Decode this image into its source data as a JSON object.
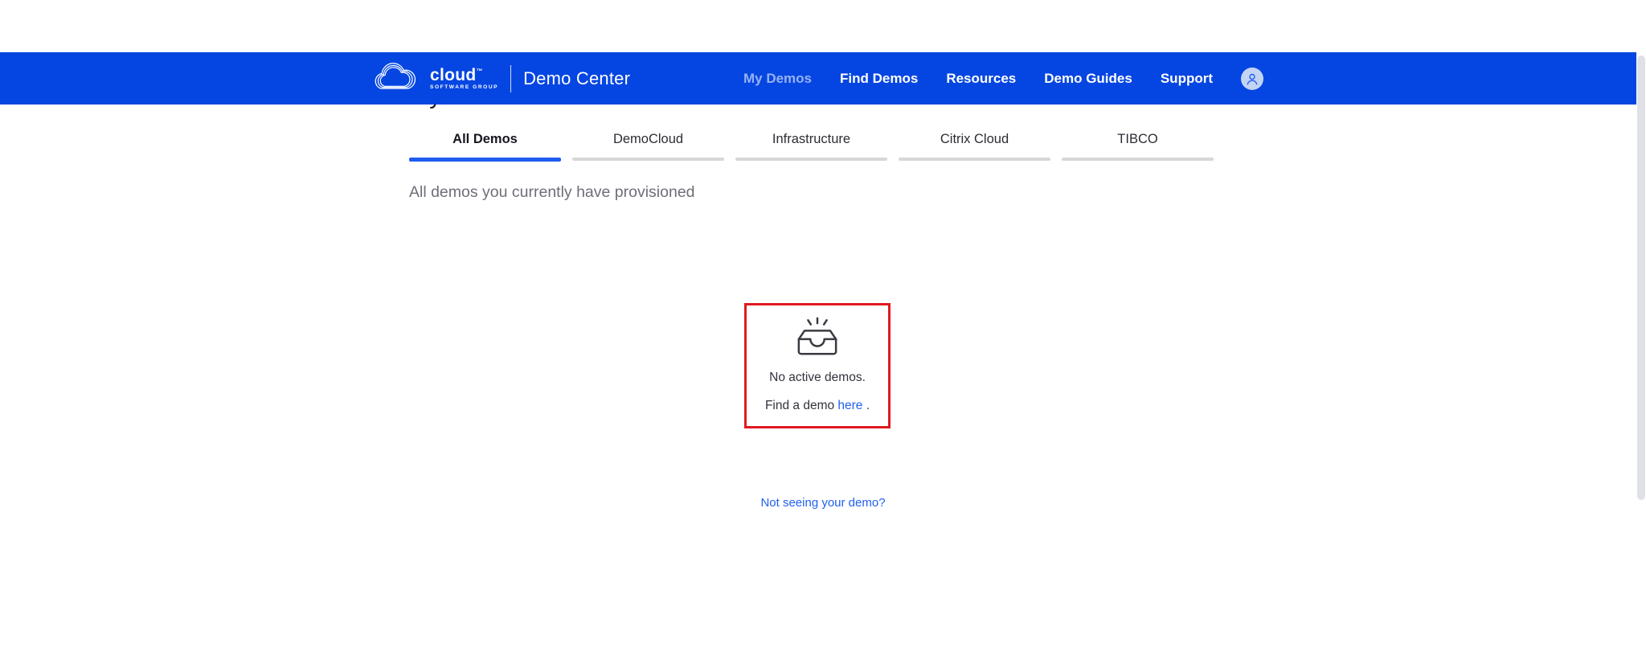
{
  "brand": {
    "logo_text": "cloud",
    "logo_tm": "™",
    "logo_subtext": "SOFTWARE GROUP",
    "app_name": "Demo Center"
  },
  "header": {
    "nav": [
      {
        "label": "My Demos",
        "active": true
      },
      {
        "label": "Find Demos",
        "active": false
      },
      {
        "label": "Resources",
        "active": false
      },
      {
        "label": "Demo Guides",
        "active": false
      },
      {
        "label": "Support",
        "active": false
      }
    ],
    "avatar_icon": "user-avatar-icon"
  },
  "page": {
    "title": "My Demos",
    "tabs": [
      {
        "label": "All Demos",
        "active": true
      },
      {
        "label": "DemoCloud",
        "active": false
      },
      {
        "label": "Infrastructure",
        "active": false
      },
      {
        "label": "Citrix Cloud",
        "active": false
      },
      {
        "label": "TIBCO",
        "active": false
      }
    ],
    "subtitle": "All demos you currently have provisioned",
    "empty_state": {
      "icon": "empty-inbox-icon",
      "line1": "No active demos.",
      "line2_prefix": "Find a demo ",
      "line2_link": "here",
      "line2_suffix": " ."
    },
    "footer_link": "Not seeing your demo?"
  },
  "colors": {
    "header_blue": "#0546e2",
    "link_blue": "#2160f0",
    "active_tab_blue": "#1f5cf0",
    "annotation_red": "#e0191f",
    "inactive_tab_bar": "#d7d7d9",
    "subtitle_grey": "#6e6e79",
    "scrollbar_grey": "#dfe1e6"
  }
}
